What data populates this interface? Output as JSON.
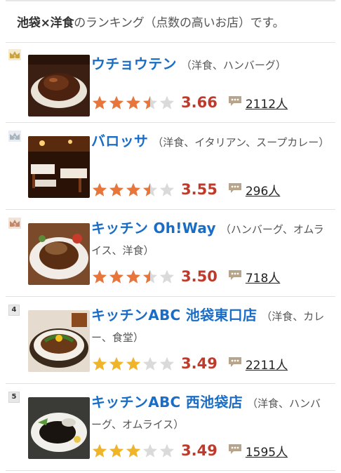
{
  "heading": {
    "prefix": "池袋×洋食",
    "suffix": "のランキング（点数の高いお店）です。"
  },
  "colors": {
    "link": "#1a6dc6",
    "score": "#c0392b",
    "star_orange": "#e8763a",
    "star_yellow": "#f0b429",
    "star_empty": "#dadada",
    "gold": "#c9a33b",
    "silver": "#aab4be",
    "bronze": "#c1896a"
  },
  "restaurants": [
    {
      "rank": "1",
      "badge": "crown-gold",
      "name": "ウチョウテン",
      "genre": "（洋食、ハンバーグ）",
      "score": "3.66",
      "rating": 3.66,
      "reviews": "2112人",
      "star_color": "orange"
    },
    {
      "rank": "2",
      "badge": "crown-silver",
      "name": "バロッサ",
      "genre": "（洋食、イタリアン、スープカレー）",
      "score": "3.55",
      "rating": 3.55,
      "reviews": "296人",
      "star_color": "orange"
    },
    {
      "rank": "3",
      "badge": "crown-bronze",
      "name": "キッチン Oh!Way",
      "genre": "（ハンバーグ、オムライス、洋食）",
      "score": "3.50",
      "rating": 3.5,
      "reviews": "718人",
      "star_color": "orange"
    },
    {
      "rank": "4",
      "badge": "number",
      "name": "キッチンABC 池袋東口店",
      "genre": "（洋食、カレー、食堂）",
      "score": "3.49",
      "rating": 3.0,
      "reviews": "2211人",
      "star_color": "yellow"
    },
    {
      "rank": "5",
      "badge": "number",
      "name": "キッチンABC 西池袋店",
      "genre": "（洋食、ハンバーグ、オムライス）",
      "score": "3.49",
      "rating": 3.0,
      "reviews": "1595人",
      "star_color": "yellow"
    }
  ]
}
